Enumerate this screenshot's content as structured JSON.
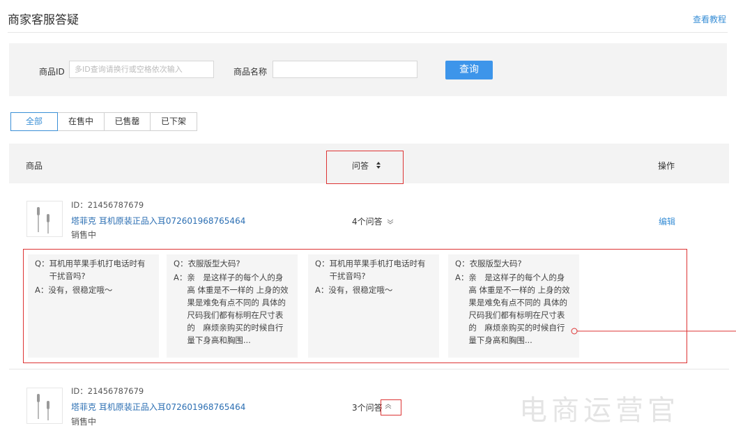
{
  "header": {
    "title": "商家客服答疑",
    "tutorial_link": "查看教程"
  },
  "search": {
    "product_id_label": "商品ID",
    "product_id_placeholder": "多ID查询请换行或空格依次输入",
    "product_name_label": "商品名称",
    "product_name_value": "",
    "query_button": "查询"
  },
  "tabs": [
    {
      "label": "全部",
      "active": true
    },
    {
      "label": "在售中",
      "active": false
    },
    {
      "label": "已售罄",
      "active": false
    },
    {
      "label": "已下架",
      "active": false
    }
  ],
  "table": {
    "col_product": "商品",
    "col_qa": "问答",
    "col_action": "操作",
    "sort_icon": "sort-icon"
  },
  "rows": [
    {
      "id": "ID：21456787679",
      "name": "塔菲克 耳机原装正品入耳072601968765464",
      "status": "销售中",
      "qa_count": "4个问答",
      "toggle_icon": "chevron-down-icon",
      "edit_label": "编辑",
      "qa_cards": [
        {
          "q_prefix": "Q：",
          "q": "耳机用苹果手机打电话时有干扰音吗?",
          "a_prefix": "A：",
          "a": "没有，很稳定哦～"
        },
        {
          "q_prefix": "Q：",
          "q": "衣服版型大码?",
          "a_prefix": "A：",
          "a": "亲　是这样子的每个人的身高 体重是不一样的 上身的效　　果是难免有点不同的 具体的尺码我们都有标明在尺寸表的　麻烦亲购买的时候自行量下身高和胸围..."
        },
        {
          "q_prefix": "Q：",
          "q": "耳机用苹果手机打电话时有干扰音吗?",
          "a_prefix": "A：",
          "a": "没有，很稳定哦～"
        },
        {
          "q_prefix": "Q：",
          "q": "衣服版型大码?",
          "a_prefix": "A：",
          "a": "亲　是这样子的每个人的身高 体重是不一样的 上身的效　　果是难免有点不同的 具体的尺码我们都有标明在尺寸表的　麻烦亲购买的时候自行量下身高和胸围..."
        }
      ]
    },
    {
      "id": "ID：21456787679",
      "name": "塔菲克 耳机原装正品入耳072601968765464",
      "status": "销售中",
      "qa_count": "3个问答",
      "toggle_icon": "chevron-up-icon"
    }
  ],
  "watermark": "电商运营官",
  "colors": {
    "accent": "#3d95ea",
    "link": "#2c6fb3",
    "highlight_border": "#d33",
    "panel_bg": "#f3f3f3"
  }
}
